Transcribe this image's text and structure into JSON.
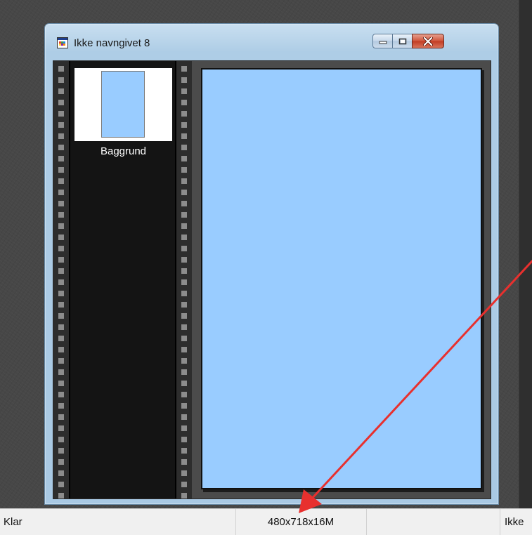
{
  "window": {
    "title": "Ikke navngivet 8",
    "icon": "image-document-icon",
    "buttons": [
      "minimize-icon",
      "maximize-icon",
      "close-icon"
    ]
  },
  "layers": [
    {
      "name": "Baggrund",
      "color": "#99ccff"
    }
  ],
  "canvas": {
    "color": "#99ccff"
  },
  "statusbar": {
    "left_text": "Klar",
    "center_text": "480x718x16M",
    "right_text": "Ikke"
  },
  "colors": {
    "canvas_fill": "#99ccff",
    "annotation_arrow": "#e8302e",
    "workspace": "#474747"
  }
}
